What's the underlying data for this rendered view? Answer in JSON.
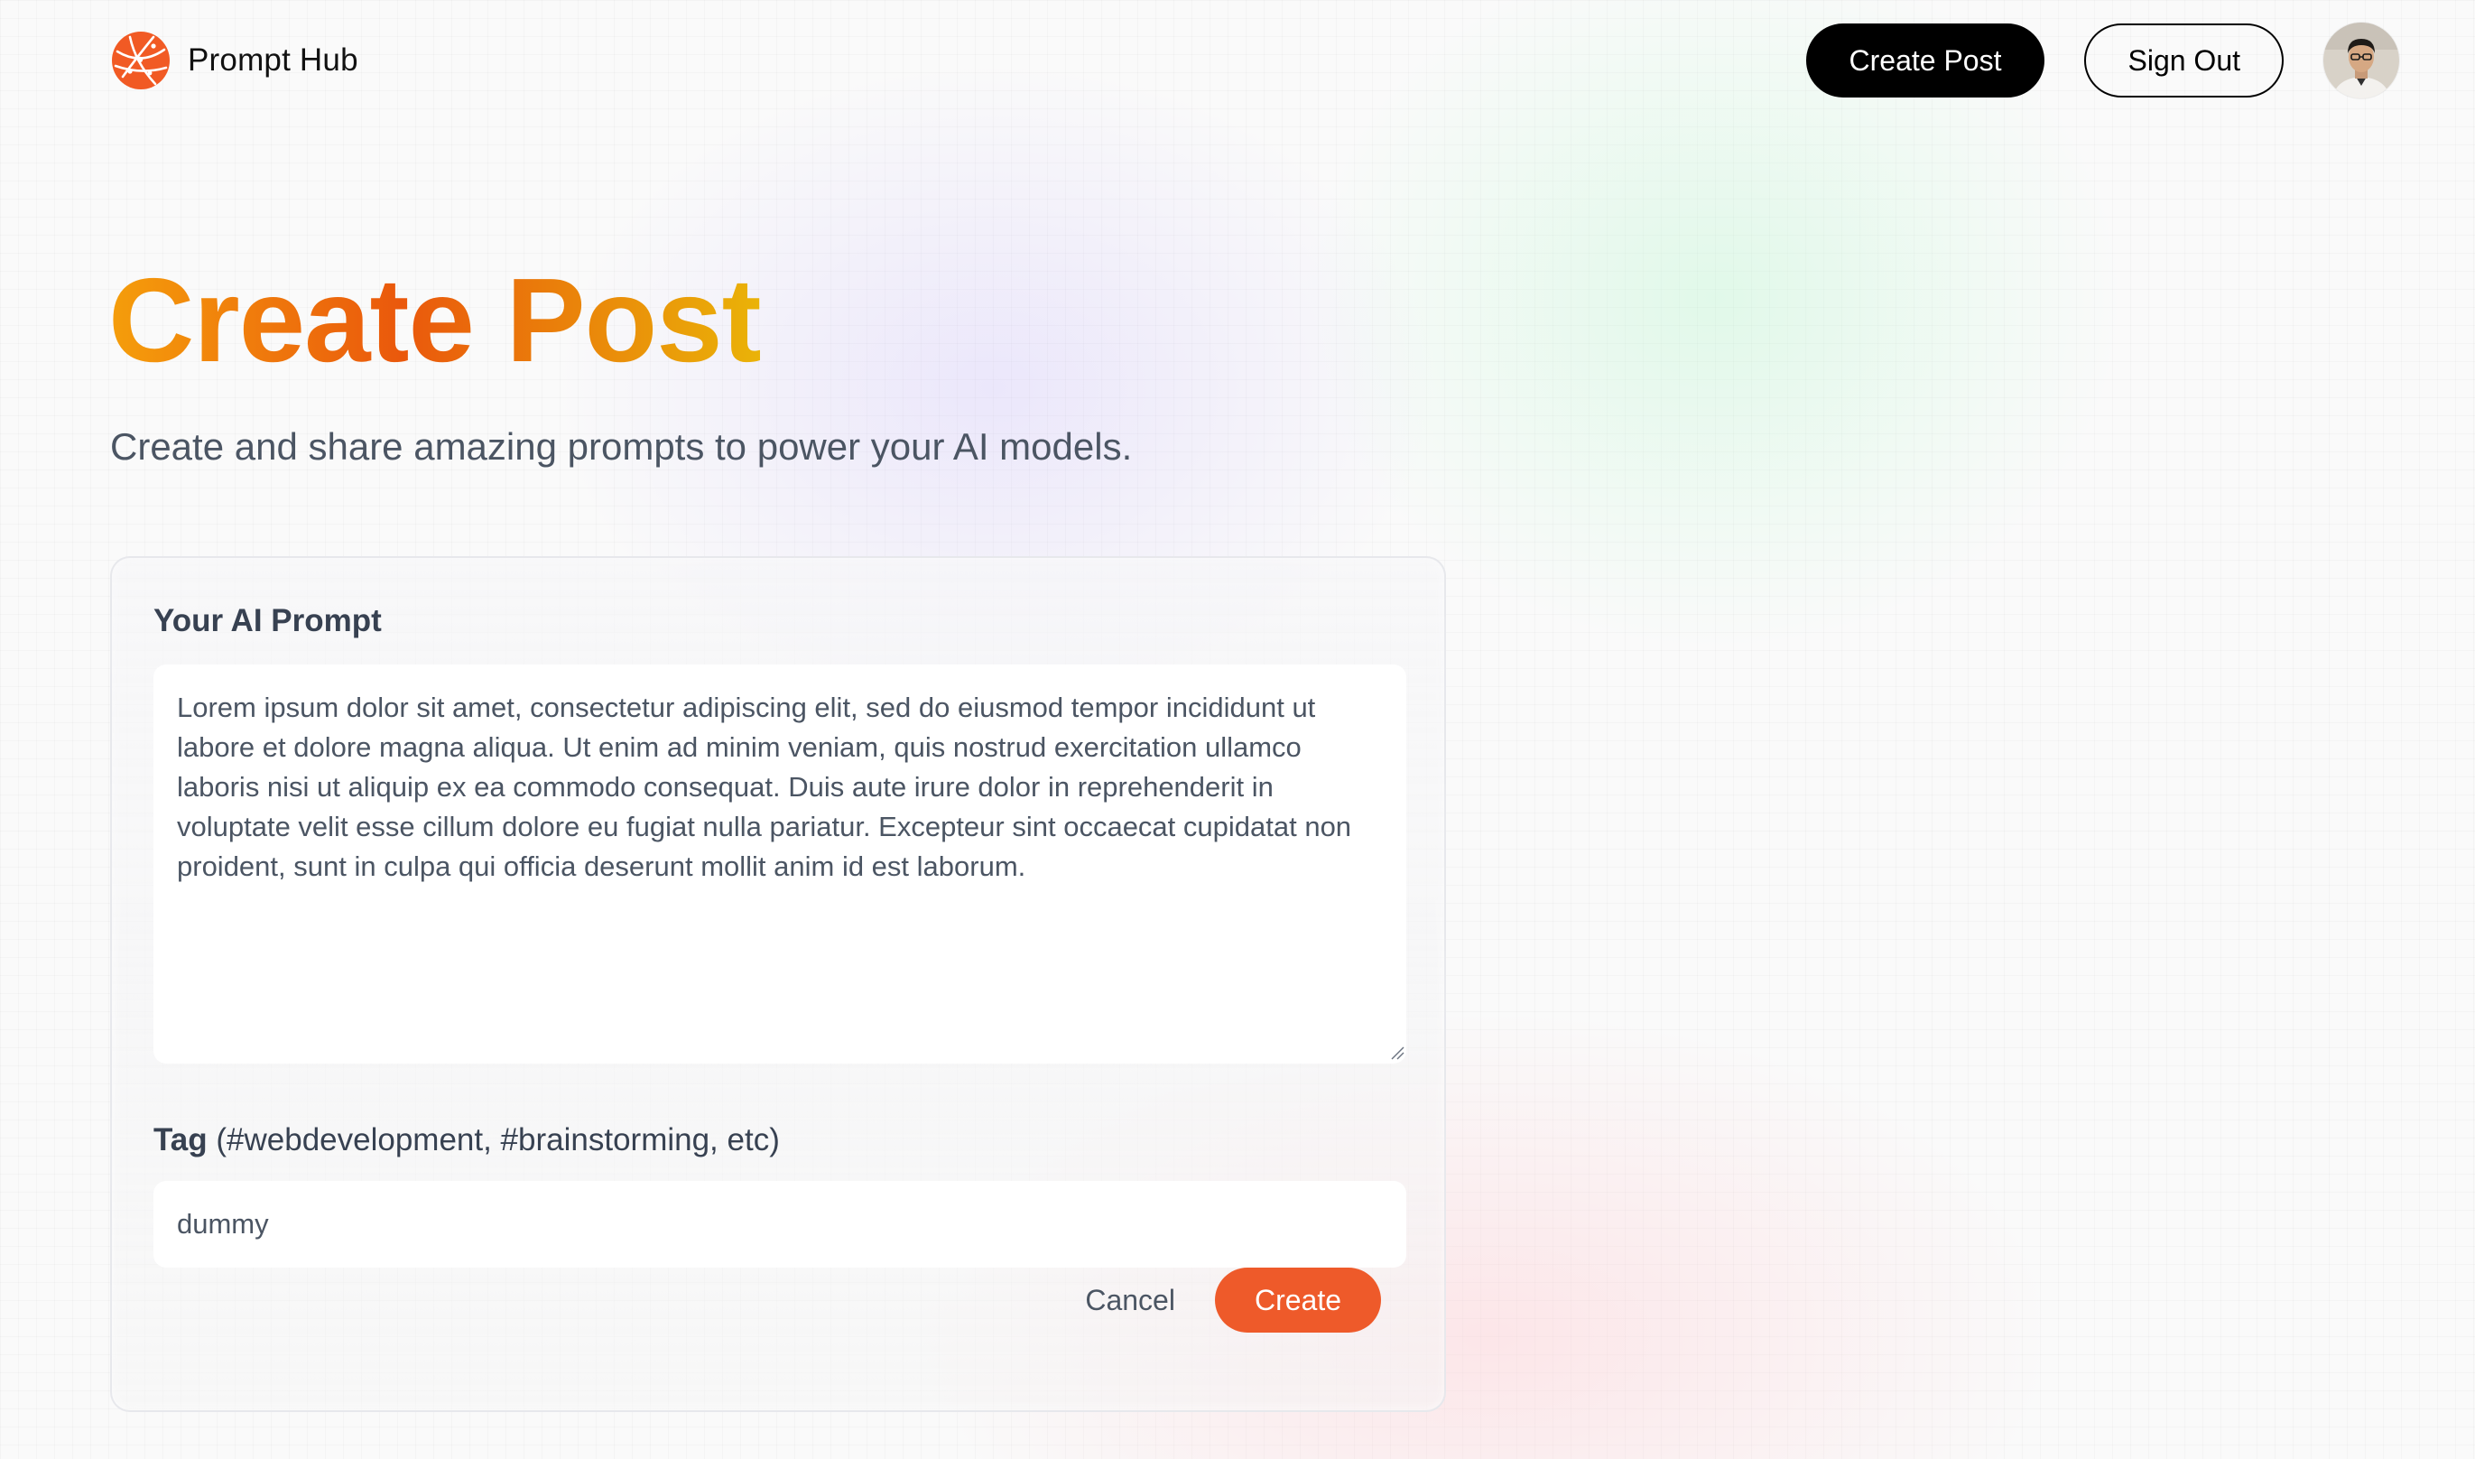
{
  "header": {
    "brand_name": "Prompt Hub",
    "logo_icon": "globe-network-icon",
    "create_post_label": "Create Post",
    "sign_out_label": "Sign Out",
    "avatar_icon": "user-avatar"
  },
  "hero": {
    "title": "Create Post",
    "subtitle": "Create and share amazing prompts to power your AI models."
  },
  "form": {
    "prompt_label": "Your AI Prompt",
    "prompt_value": "Lorem ipsum dolor sit amet, consectetur adipiscing elit, sed do eiusmod tempor incididunt ut labore et dolore magna aliqua. Ut enim ad minim veniam, quis nostrud exercitation ullamco laboris nisi ut aliquip ex ea commodo consequat. Duis aute irure dolor in reprehenderit in voluptate velit esse cillum dolore eu fugiat nulla pariatur. Excepteur sint occaecat cupidatat non proident, sunt in culpa qui officia deserunt mollit anim id est laborum.",
    "tag_label_strong": "Tag",
    "tag_label_hint": " (#webdevelopment, #brainstorming, etc)",
    "tag_value": "dummy",
    "cancel_label": "Cancel",
    "submit_label": "Create"
  },
  "colors": {
    "accent": "#ee5a2a",
    "title_gradient": [
      "#f59e0b",
      "#ea580c",
      "#eab308"
    ],
    "primary_button": "#000000"
  }
}
